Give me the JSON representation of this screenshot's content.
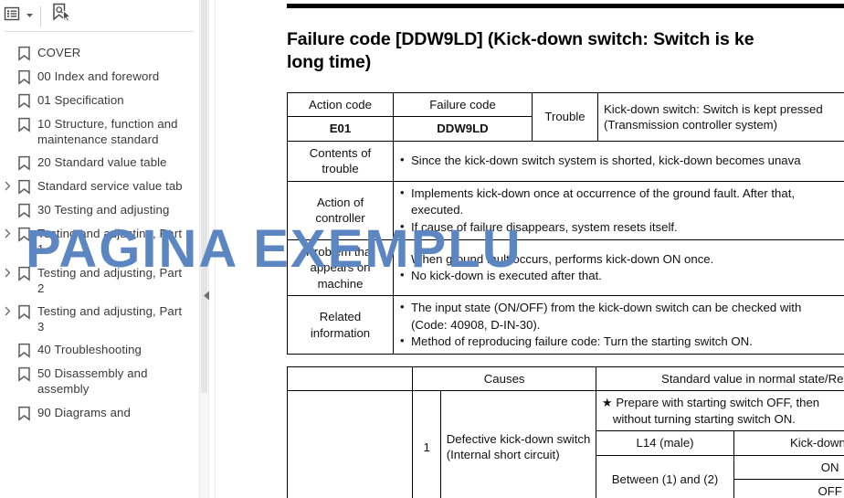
{
  "sidebar": {
    "toolbar": {
      "options_label": "Bookmark options",
      "options_icon": "list-options-icon",
      "dropdown_icon": "chevron-down-icon",
      "new_bookmark_label": "New bookmark",
      "new_bookmark_icon": "bookmark-cursor-icon"
    },
    "collapse_icon": "chevron-left-icon",
    "items": [
      {
        "label": "COVER",
        "expandable": false
      },
      {
        "label": "00 Index and foreword",
        "expandable": false
      },
      {
        "label": "01 Specification",
        "expandable": false
      },
      {
        "label": "10 Structure, function and maintenance standard",
        "expandable": false
      },
      {
        "label": "20 Standard value table",
        "expandable": false
      },
      {
        "label": "Standard service value tab",
        "expandable": true
      },
      {
        "label": "30 Testing and adjusting",
        "expandable": false
      },
      {
        "label": "Testing and adjusting, Part 1",
        "expandable": true
      },
      {
        "label": "Testing and adjusting, Part 2",
        "expandable": true
      },
      {
        "label": "Testing and adjusting, Part 3",
        "expandable": true
      },
      {
        "label": "40 Troubleshooting",
        "expandable": false
      },
      {
        "label": "50 Disassembly and assembly",
        "expandable": false
      },
      {
        "label": "90 Diagrams and",
        "expandable": false
      }
    ]
  },
  "document": {
    "title": "Failure code [DDW9LD] (Kick-down switch: Switch is ke\nlong time)",
    "main_table": {
      "action_code_header": "Action code",
      "action_code_value": "E01",
      "failure_code_header": "Failure code",
      "failure_code_value": "DDW9LD",
      "trouble_header": "Trouble",
      "trouble_text_line1": "Kick-down switch: Switch is kept pressed",
      "trouble_text_line2": "(Transmission controller system)",
      "rows": [
        {
          "label": "Contents of trouble",
          "bullets": [
            "Since the kick-down switch system is shorted, kick-down becomes unava"
          ]
        },
        {
          "label": "Action of controller",
          "bullets": [
            "Implements kick-down once at occurrence of the ground fault. After that,",
            "executed.",
            "If cause of failure disappears, system resets itself."
          ]
        },
        {
          "label": "Problem that appears on machine",
          "bullets": [
            "When ground fault occurs, performs kick-down ON once.",
            "No kick-down is executed after that."
          ]
        },
        {
          "label": "Related information",
          "bullets": [
            "The input state (ON/OFF) from the kick-down switch can be checked with",
            "(Code: 40908, D-IN-30).",
            "Method of reproducing failure code: Turn the starting switch ON."
          ]
        }
      ]
    },
    "causes_table": {
      "causes_header": "Causes",
      "standard_value_header": "Standard value in normal state/Rema",
      "note_line1": "★ Prepare with starting switch OFF, then",
      "note_line2": "without turning starting switch ON.",
      "rows": [
        {
          "number": "1",
          "cause_line1": "Defective kick-down switch",
          "cause_line2": "(Internal short circuit)",
          "measure_header_left": "L14 (male)",
          "measure_header_right": "Kick-down swit",
          "measure_label": "Between (1) and (2)",
          "state_on": "ON",
          "state_off": "OFF"
        }
      ]
    }
  },
  "watermark": {
    "text": "PAGINA EXEMPLU",
    "color": "#5b86c2"
  }
}
